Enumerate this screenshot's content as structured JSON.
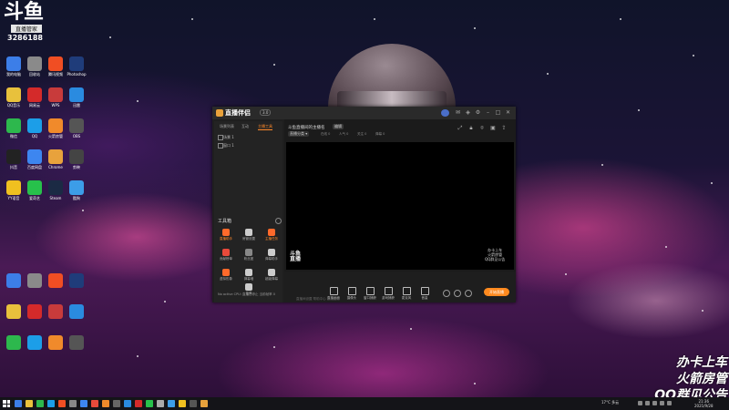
{
  "desktop": {
    "profile": {
      "logo": "斗鱼",
      "badge": "直播管家",
      "number": "3286188"
    },
    "icons": [
      {
        "label": "我的电脑",
        "color": "#3c7ee8"
      },
      {
        "label": "回收站",
        "color": "#8a8a8a"
      },
      {
        "label": "腾讯视频",
        "color": "#f04e23"
      },
      {
        "label": "Photoshop",
        "color": "#1f3c7a"
      },
      {
        "label": "QQ音乐",
        "color": "#e8c13c"
      },
      {
        "label": "网易云",
        "color": "#d42a2a"
      },
      {
        "label": "WPS",
        "color": "#c83b3b"
      },
      {
        "label": "迅雷",
        "color": "#2a8be0"
      },
      {
        "label": "微信",
        "color": "#2db84d"
      },
      {
        "label": "QQ",
        "color": "#1c9ee8"
      },
      {
        "label": "火箭房管",
        "color": "#f08a2b"
      },
      {
        "label": "OBS",
        "color": "#555"
      },
      {
        "label": "抖音",
        "color": "#222"
      },
      {
        "label": "百度网盘",
        "color": "#3d86f0"
      },
      {
        "label": "Chrome",
        "color": "#e8a23c"
      },
      {
        "label": "剪映",
        "color": "#444"
      },
      {
        "label": "YY语音",
        "color": "#f0c020"
      },
      {
        "label": "爱奇艺",
        "color": "#27c14b"
      },
      {
        "label": "Steam",
        "color": "#1b2a44"
      },
      {
        "label": "酷狗",
        "color": "#3c9de8"
      }
    ],
    "watermark": [
      "办卡上车",
      "火箭房管",
      "QQ群见公告"
    ]
  },
  "app": {
    "name": "直播伴侣",
    "version": "3.0",
    "left_tabs": [
      "场景列表",
      "互动",
      "主播工具"
    ],
    "scenes": [
      "场景 1",
      "窗口 1"
    ],
    "tools_title": "工具箱",
    "tools": [
      {
        "label": "直播助手",
        "color": "#ff6a2b"
      },
      {
        "label": "房管设置",
        "color": "#cccccc"
      },
      {
        "label": "主播任务",
        "color": "#ff6a2b"
      },
      {
        "label": "贡献榜单",
        "color": "#e84a3b"
      },
      {
        "label": "粉丝团",
        "color": "#888888"
      },
      {
        "label": "弹幕助手",
        "color": "#cccccc"
      },
      {
        "label": "虚拟形象",
        "color": "#ff6a2b"
      },
      {
        "label": "弹幕墙",
        "color": "#cccccc"
      },
      {
        "label": "超级弹幕",
        "color": "#cccccc"
      },
      {
        "label": "录像",
        "color": "#cccccc"
      }
    ],
    "left_status": "No active CPU: 直播已停止 当前帧率 0",
    "room_title": "斗鱼直播间的主播名",
    "room_tag": "编辑",
    "room_category": "直播分类 ▾",
    "stats": [
      "在线 0",
      "人气 0",
      "关注 0",
      "弹幕 0"
    ],
    "preview_logo": [
      "斗鱼",
      "直播"
    ],
    "preview_watermark": [
      "办卡上车",
      "火箭房管",
      "QQ群见公告"
    ],
    "controls": [
      "直播画面",
      "摄像头",
      "窗口捕获",
      "游戏捕获",
      "麦克风",
      "音量"
    ],
    "start_label": "开始直播",
    "footer": "直播间设置  帮助中心  意见反馈"
  },
  "taskbar": {
    "weather": "17°C 多云",
    "time": "21:36",
    "date": "2021/9/28"
  }
}
